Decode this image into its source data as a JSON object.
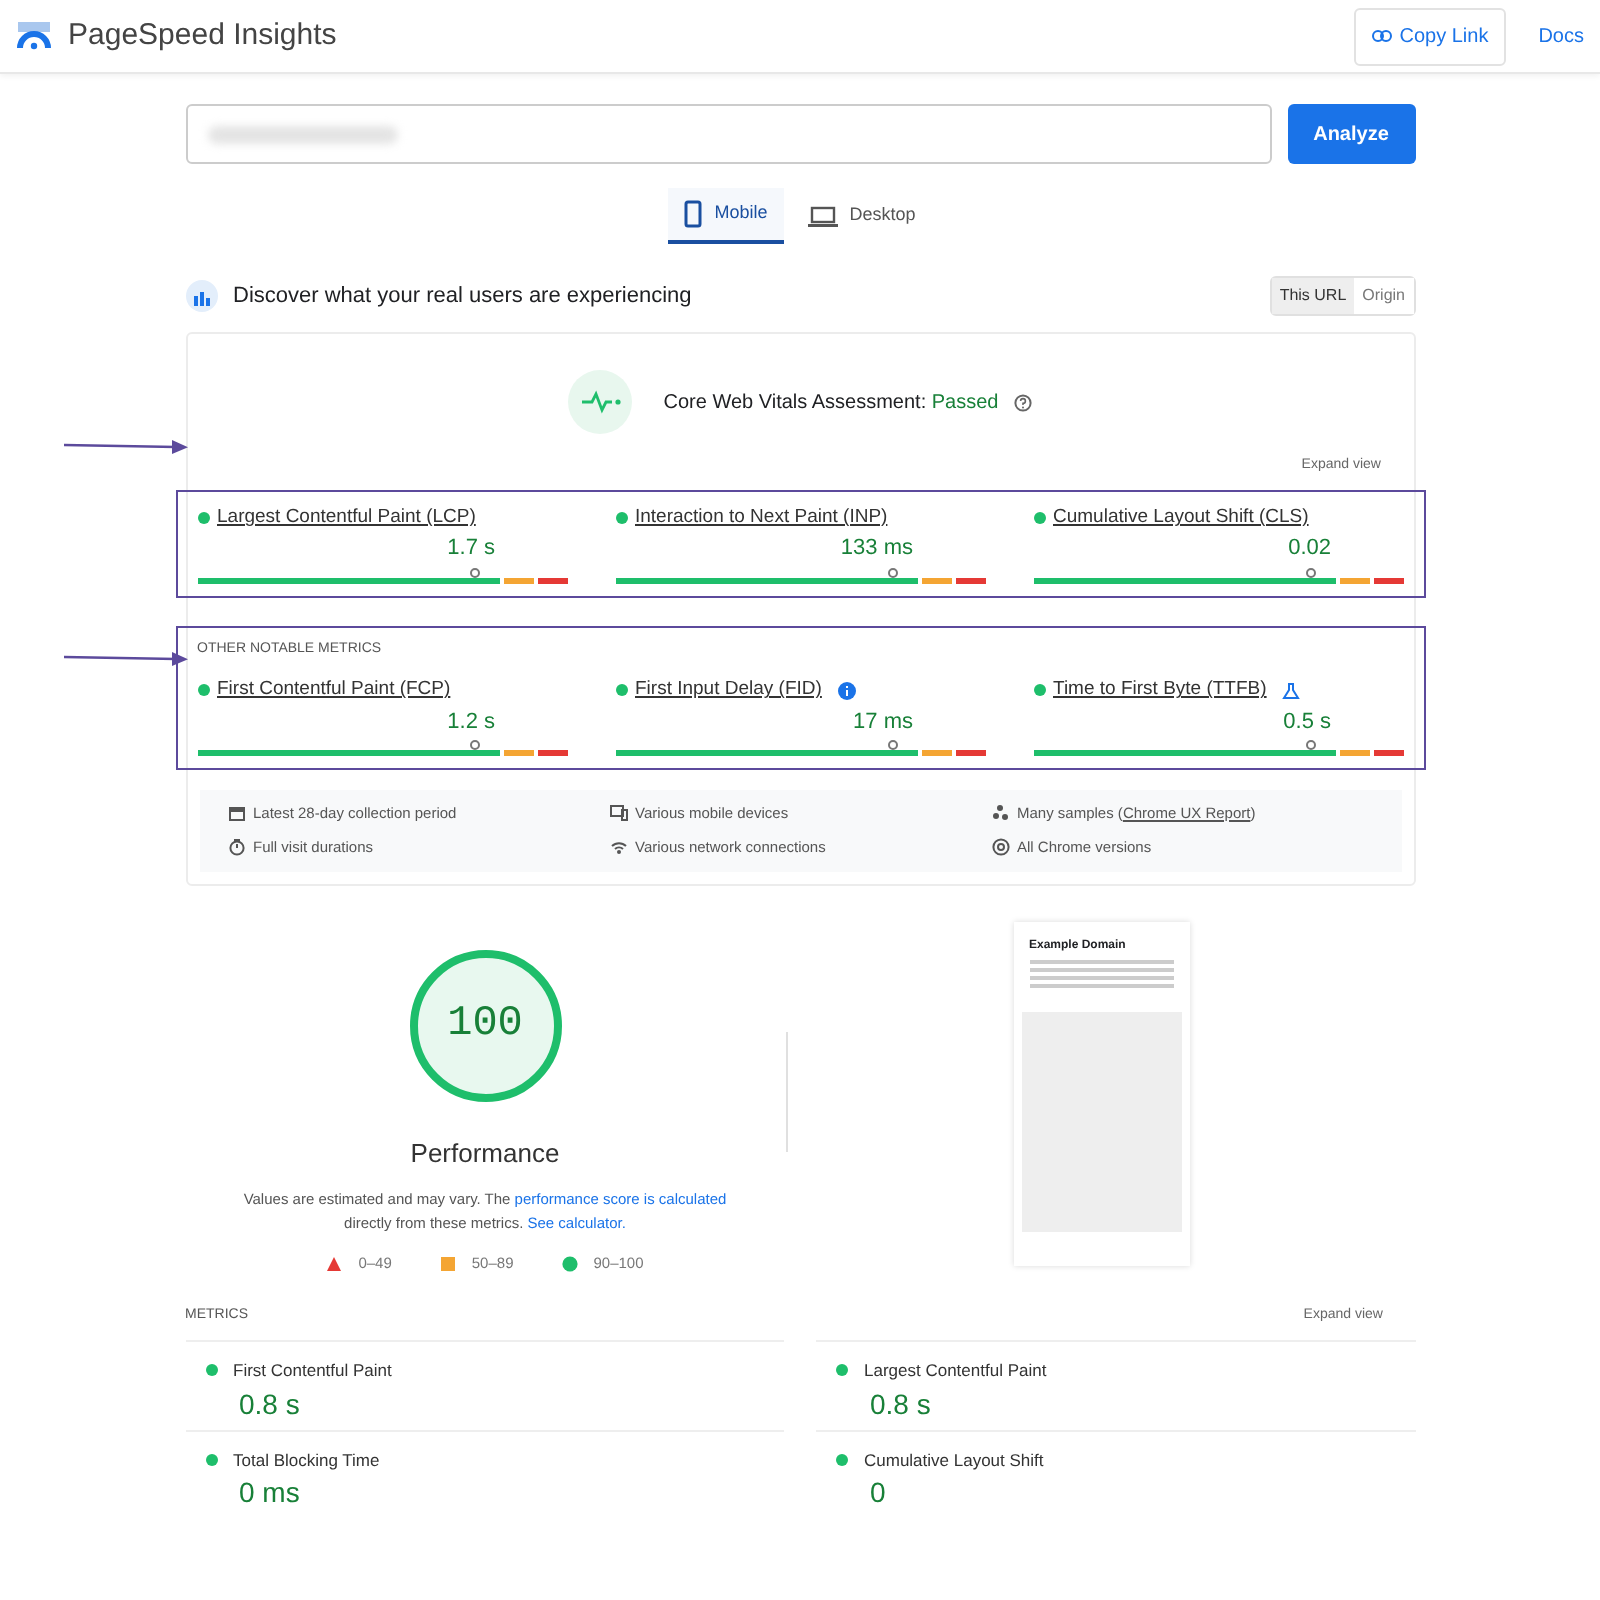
{
  "header": {
    "title": "PageSpeed Insights",
    "copy_link": "Copy Link",
    "docs": "Docs"
  },
  "search": {
    "button": "Analyze"
  },
  "device_tabs": [
    {
      "label": "Mobile",
      "kind": "phone",
      "selected": true
    },
    {
      "label": "Desktop",
      "kind": "laptop",
      "selected": false
    }
  ],
  "field_data": {
    "heading": "Discover what your real users are experiencing",
    "scope_toggle": [
      {
        "label": "This URL",
        "selected": true
      },
      {
        "label": "Origin",
        "selected": false
      }
    ],
    "assessment": {
      "label": "Core Web Vitals Assessment:",
      "result": "Passed"
    },
    "expand": "Expand view",
    "core_metrics": [
      {
        "name": "Largest Contentful Paint (LCP)",
        "value": "1.7 s",
        "level": 0.75
      },
      {
        "name": "Interaction to Next Paint (INP)",
        "value": "133 ms",
        "level": 0.75
      },
      {
        "name": "Cumulative Layout Shift (CLS)",
        "value": "0.02",
        "level": 0.75
      }
    ],
    "other_heading": "OTHER NOTABLE METRICS",
    "other_metrics": [
      {
        "name": "First Contentful Paint (FCP)",
        "value": "1.2 s",
        "level": 0.75
      },
      {
        "name": "First Input Delay (FID)",
        "value": "17 ms",
        "level": 0.75
      },
      {
        "name": "Time to First Byte (TTFB)",
        "value": "0.5 s",
        "level": 0.75
      }
    ],
    "info": [
      {
        "text": "Latest 28-day collection period"
      },
      {
        "text": "Various mobile devices"
      },
      {
        "text": "Many samples (",
        "link": "Chrome UX Report",
        "tail": ")"
      },
      {
        "text": "Full visit durations"
      },
      {
        "text": "Various network connections"
      },
      {
        "text": "All Chrome versions"
      }
    ]
  },
  "lab": {
    "score": "100",
    "category": "Performance",
    "note": {
      "text": "Values are estimated and may vary. The ",
      "link1": "performance score is calculated",
      "mid": " directly from these metrics. ",
      "link2": "See calculator."
    },
    "legend": [
      {
        "kind": "triangle",
        "color": "#e53935",
        "label": "0–49"
      },
      {
        "kind": "square",
        "color": "#f4a533",
        "label": "50–89"
      },
      {
        "kind": "circle",
        "color": "#1ebe6b",
        "label": "90–100"
      }
    ],
    "preview_title": "Example Domain",
    "metrics_heading": "METRICS",
    "expand": "Expand view",
    "metrics": [
      {
        "name": "First Contentful Paint",
        "value": "0.8 s"
      },
      {
        "name": "Largest Contentful Paint",
        "value": "0.8 s"
      },
      {
        "name": "Total Blocking Time",
        "value": "0 ms"
      },
      {
        "name": "Cumulative Layout Shift",
        "value": "0"
      }
    ]
  }
}
